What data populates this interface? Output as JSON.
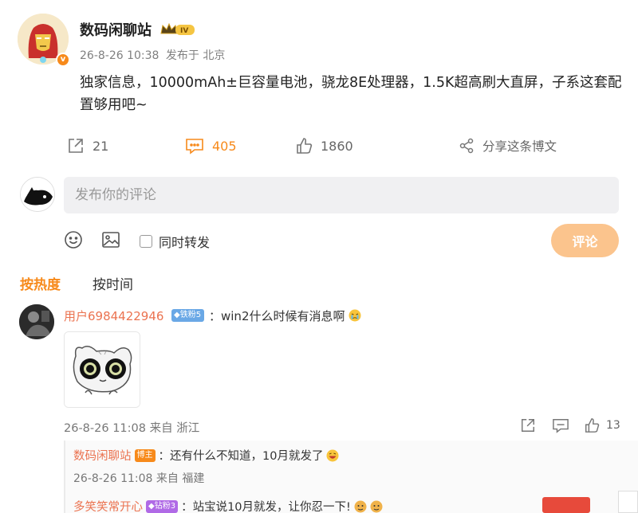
{
  "post": {
    "author": "数码闲聊站",
    "level_badge": "IV",
    "date": "26-8-26 10:38",
    "source": "发布于 北京",
    "content": "独家信息，10000mAh±巨容量电池，骁龙8E处理器，1.5K超高刷大直屏，子系这套配置够用吧~",
    "actions": {
      "repost_count": "21",
      "comment_count": "405",
      "like_count": "1860",
      "share_label": "分享这条博文"
    }
  },
  "composer": {
    "placeholder": "发布你的评论",
    "repost_label": "同时转发",
    "submit_label": "评论"
  },
  "sort_tabs": {
    "hot": "按热度",
    "time": "按时间"
  },
  "comments": [
    {
      "user": "用户6984422946",
      "fan_badge": "铁粉5",
      "text": "：win2什么时候有消息啊",
      "date": "26-8-26 11:08",
      "location": "来自 浙江",
      "like_count": "13",
      "replies": [
        {
          "user": "数码闲聊站",
          "badge": "博主",
          "text": "：还有什么不知道，10月就发了",
          "date": "26-8-26 11:08",
          "location": "来自 福建"
        },
        {
          "user": "多笑笑常开心",
          "badge": "钻粉3",
          "text": "：站宝说10月就发，让你忍一下!"
        }
      ]
    }
  ],
  "colors": {
    "accent": "#f78a1b",
    "username": "#eb7350",
    "submit_disabled": "#fbc48d"
  },
  "icons": [
    "repost-icon",
    "comment-icon",
    "like-icon",
    "share-icon",
    "emoji-icon",
    "image-icon",
    "verified-icon",
    "crown-icon",
    "cry-emoji-icon",
    "laugh-emoji-icon",
    "doge-emoji-icon"
  ]
}
